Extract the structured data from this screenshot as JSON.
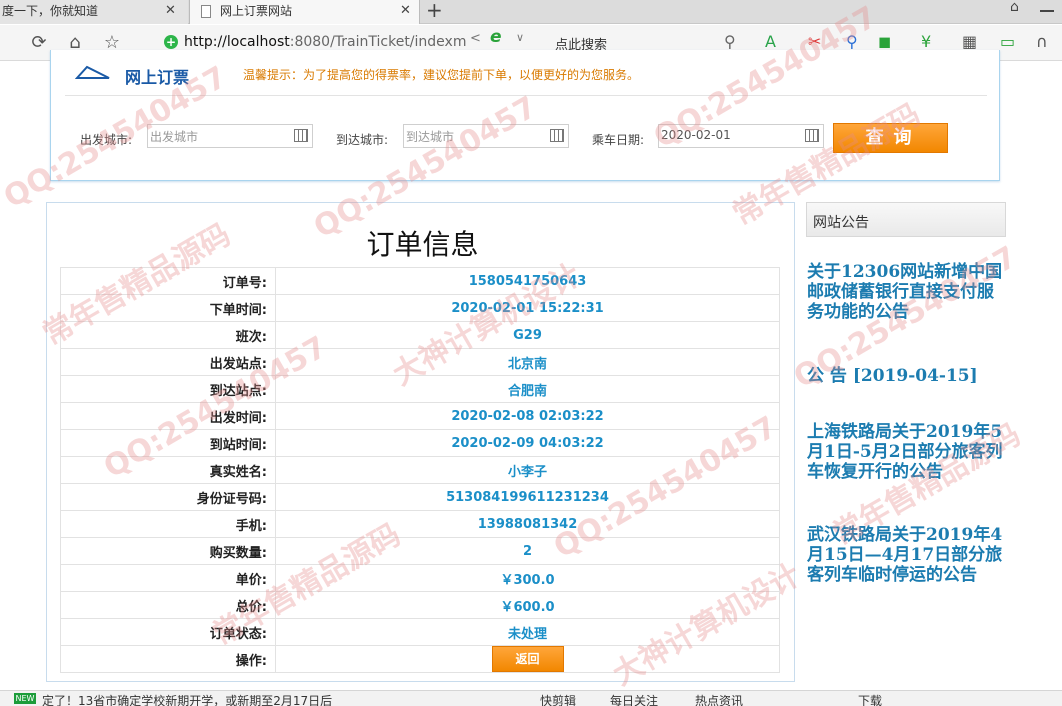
{
  "browser": {
    "tabs": [
      {
        "title": "度一下，你就知道",
        "close": "✕"
      },
      {
        "title": "网上订票网站",
        "close": "✕"
      }
    ],
    "new_tab": "+",
    "url": {
      "host": "http://localhost",
      "rest": ":8080/TrainTicket/indexm"
    },
    "search_button": "点此搜索"
  },
  "header": {
    "logo": "网上订票",
    "tip": "温馨提示：为了提高您的得票率，建议您提前下单，以便更好的为您服务。",
    "departure": {
      "label": "出发城市:",
      "placeholder": "出发城市"
    },
    "arrival": {
      "label": "到达城市:",
      "placeholder": "到达城市"
    },
    "date": {
      "label": "乘车日期:",
      "value": "2020-02-01"
    },
    "query_button": "查询"
  },
  "order": {
    "title": "订单信息",
    "rows": [
      {
        "label": "订单号:",
        "value": "1580541750643"
      },
      {
        "label": "下单时间:",
        "value": "2020-02-01 15:22:31"
      },
      {
        "label": "班次:",
        "value": "G29"
      },
      {
        "label": "出发站点:",
        "value": "北京南"
      },
      {
        "label": "到达站点:",
        "value": "合肥南"
      },
      {
        "label": "出发时间:",
        "value": "2020-02-08 02:03:22"
      },
      {
        "label": "到站时间:",
        "value": "2020-02-09 04:03:22"
      },
      {
        "label": "真实姓名:",
        "value": "小李子"
      },
      {
        "label": "身份证号码:",
        "value": "513084199611231234"
      },
      {
        "label": "手机:",
        "value": "13988081342"
      },
      {
        "label": "购买数量:",
        "value": "2"
      },
      {
        "label": "单价:",
        "value": "￥300.0"
      },
      {
        "label": "总价:",
        "value": "￥600.0"
      },
      {
        "label": "订单状态:",
        "value": "未处理"
      }
    ],
    "action_label": "操作:",
    "back_button": "返回"
  },
  "notice": {
    "title": "网站公告",
    "items": [
      "关于12306网站新增中国邮政储蓄银行直接支付服务功能的公告",
      "公 告 [2019-04-15]",
      "上海铁路局关于2019年5月1日-5月2日部分旅客列车恢复开行的公告",
      "武汉铁路局关于2019年4月15日—4月17日部分旅客列车临时停运的公告"
    ]
  },
  "statusbar": {
    "news": "定了！13省市确定学校新期开学，或新期至2月17日后",
    "new_badge": "NEW",
    "items": [
      "快剪辑",
      "每日关注",
      "热点资讯",
      "下载"
    ]
  },
  "watermark": [
    "QQ:254540457",
    "常年售精品源码",
    "大神计算机设计"
  ]
}
